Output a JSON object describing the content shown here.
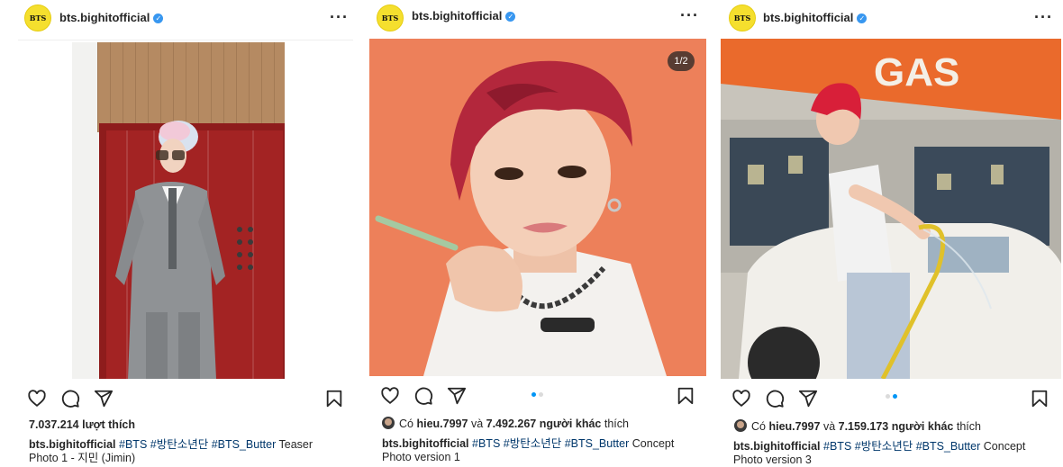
{
  "posts": [
    {
      "username": "bts.bighitofficial",
      "avatar_text": "BTS",
      "counter": "",
      "dots": [],
      "likes_count": "7.037.214",
      "likes_suffix": "lượt thích",
      "caption_tags": [
        "#BTS",
        "#방탄소년단",
        "#BTS_Butter"
      ],
      "caption_text": "Teaser Photo 1 - 지민 (Jimin)"
    },
    {
      "username": "bts.bighitofficial",
      "avatar_text": "BTS",
      "counter": "1/2",
      "dots": [
        true,
        false
      ],
      "likes_prefix": "Có",
      "liked_by": "hieu.7997",
      "likes_and": "và",
      "likes_others": "7.492.267 người khác",
      "likes_suffix": "thích",
      "caption_tags": [
        "#BTS",
        "#방탄소년단",
        "#BTS_Butter"
      ],
      "caption_text": "Concept Photo version 1"
    },
    {
      "username": "bts.bighitofficial",
      "avatar_text": "BTS",
      "counter": "",
      "dots": [
        false,
        true
      ],
      "likes_prefix": "Có",
      "liked_by": "hieu.7997",
      "likes_and": "và",
      "likes_others": "7.159.173 người khác",
      "likes_suffix": "thích",
      "caption_tags": [
        "#BTS",
        "#방탄소년단",
        "#BTS_Butter"
      ],
      "caption_text": "Concept Photo version 3",
      "sign_text": "GAS"
    }
  ],
  "icons": {
    "more": "more-icon",
    "like": "heart-icon",
    "comment": "comment-icon",
    "share": "send-icon",
    "save": "bookmark-icon"
  },
  "colors": {
    "accent": "#0095f6",
    "hashtag": "#00376b",
    "avatar_bg": "#f5df2e"
  }
}
